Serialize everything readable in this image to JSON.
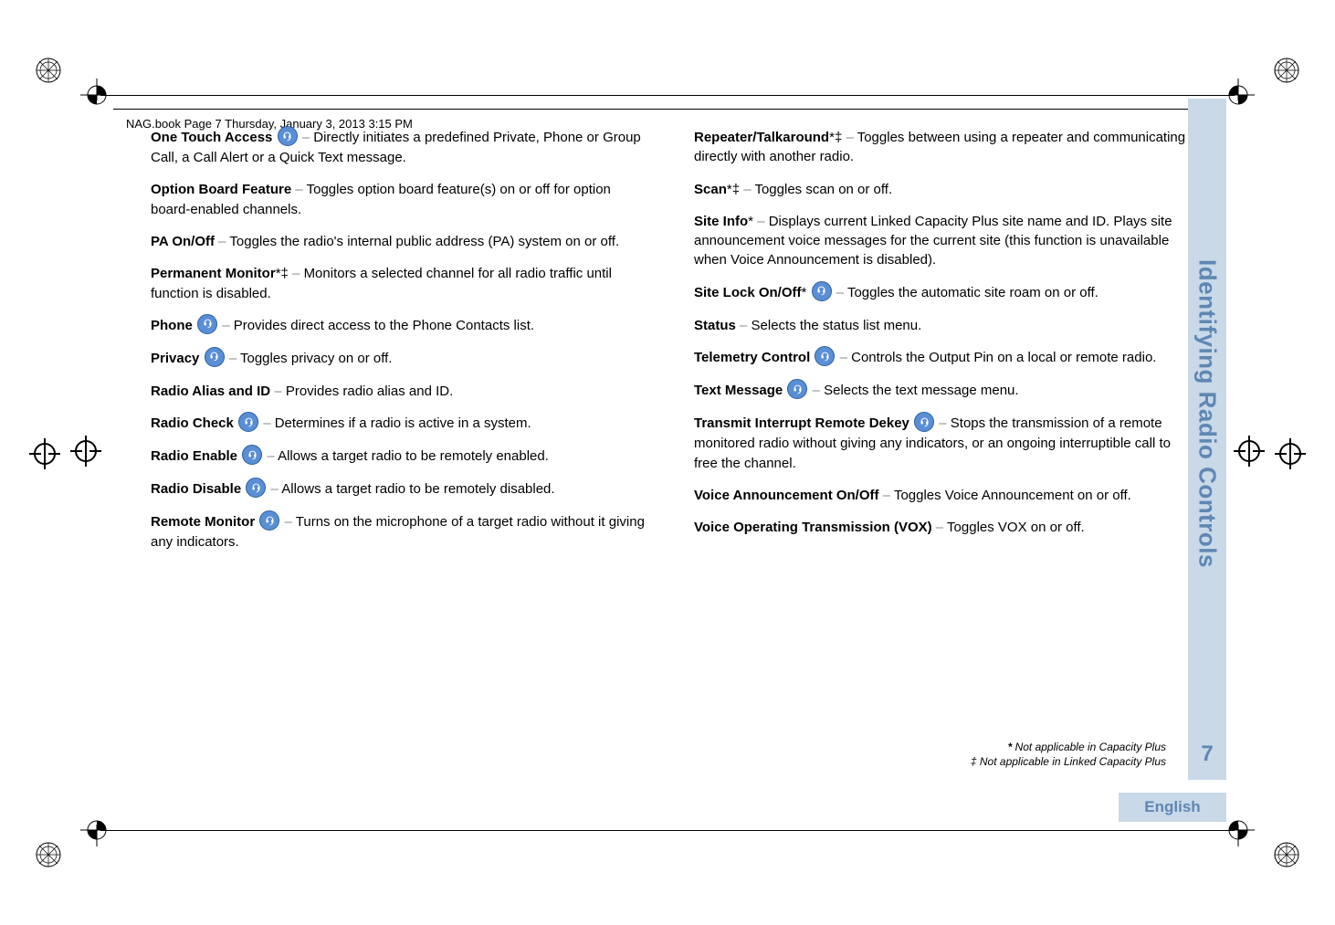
{
  "header": {
    "running": "NAG.book  Page 7  Thursday, January 3, 2013  3:15 PM"
  },
  "sidebar": {
    "title": "Identifying Radio Controls",
    "page": "7",
    "lang": "English"
  },
  "left_entries": [
    {
      "title": "One Touch Access",
      "suffix": "",
      "icon": true,
      "desc": "Directly initiates a predefined Private, Phone or Group Call, a Call Alert or a Quick Text message."
    },
    {
      "title": "Option Board Feature",
      "suffix": "",
      "icon": false,
      "desc": "Toggles option board feature(s) on or off for option board-enabled channels."
    },
    {
      "title": "PA On/Off",
      "suffix": "",
      "icon": false,
      "desc": "Toggles the radio's internal public address (PA) system on or off."
    },
    {
      "title": "Permanent Monitor",
      "suffix": "*‡",
      "icon": false,
      "desc": "Monitors a selected channel for all radio traffic until function is disabled."
    },
    {
      "title": "Phone",
      "suffix": "",
      "icon": true,
      "desc": "Provides direct access to the Phone Contacts list."
    },
    {
      "title": "Privacy",
      "suffix": "",
      "icon": true,
      "desc": "Toggles privacy on or off."
    },
    {
      "title": "Radio Alias and ID",
      "suffix": "",
      "icon": false,
      "desc": "Provides radio alias and ID."
    },
    {
      "title": "Radio Check",
      "suffix": "",
      "icon": true,
      "desc": "Determines if a radio is active in a system."
    },
    {
      "title": "Radio Enable",
      "suffix": "",
      "icon": true,
      "desc": "Allows a target radio to be remotely enabled."
    },
    {
      "title": "Radio Disable",
      "suffix": "",
      "icon": true,
      "desc": "Allows a target radio to be remotely disabled."
    },
    {
      "title": "Remote Monitor",
      "suffix": "",
      "icon": true,
      "desc": "Turns on the microphone of a target radio without it giving any indicators."
    }
  ],
  "right_entries": [
    {
      "title": "Repeater/Talkaround",
      "suffix": "*‡",
      "icon": false,
      "desc": "Toggles between using a repeater and communicating directly with another radio."
    },
    {
      "title": "Scan",
      "suffix": "*‡",
      "icon": false,
      "desc": "Toggles scan on or off."
    },
    {
      "title": "Site Info",
      "suffix": "*",
      "icon": false,
      "desc": "Displays current Linked Capacity Plus site name and ID. Plays site announcement voice messages for the current site (this function is unavailable when Voice Announcement is disabled)."
    },
    {
      "title": "Site Lock On/Off",
      "suffix": "*",
      "icon": true,
      "desc": "Toggles the automatic site roam on or off."
    },
    {
      "title": "Status",
      "suffix": "",
      "icon": false,
      "desc": "Selects the status list menu."
    },
    {
      "title": "Telemetry Control",
      "suffix": "",
      "icon": true,
      "desc": "Controls the Output Pin on a local or remote radio."
    },
    {
      "title": "Text Message",
      "suffix": "",
      "icon": true,
      "desc": "Selects the text message menu."
    },
    {
      "title": "Transmit Interrupt Remote Dekey",
      "suffix": "",
      "icon": true,
      "desc": "Stops the transmission of a remote monitored radio without giving any indicators, or an ongoing interruptible call to free the channel."
    },
    {
      "title": "Voice Announcement On/Off",
      "suffix": "",
      "icon": false,
      "desc": "Toggles Voice Announcement on or off."
    },
    {
      "title": "Voice Operating Transmission (VOX)",
      "suffix": "",
      "icon": false,
      "desc": "Toggles VOX on or off."
    }
  ],
  "footnotes": {
    "line1": "* Not applicable in Capacity Plus",
    "line2": "‡ Not applicable in Linked Capacity Plus"
  }
}
